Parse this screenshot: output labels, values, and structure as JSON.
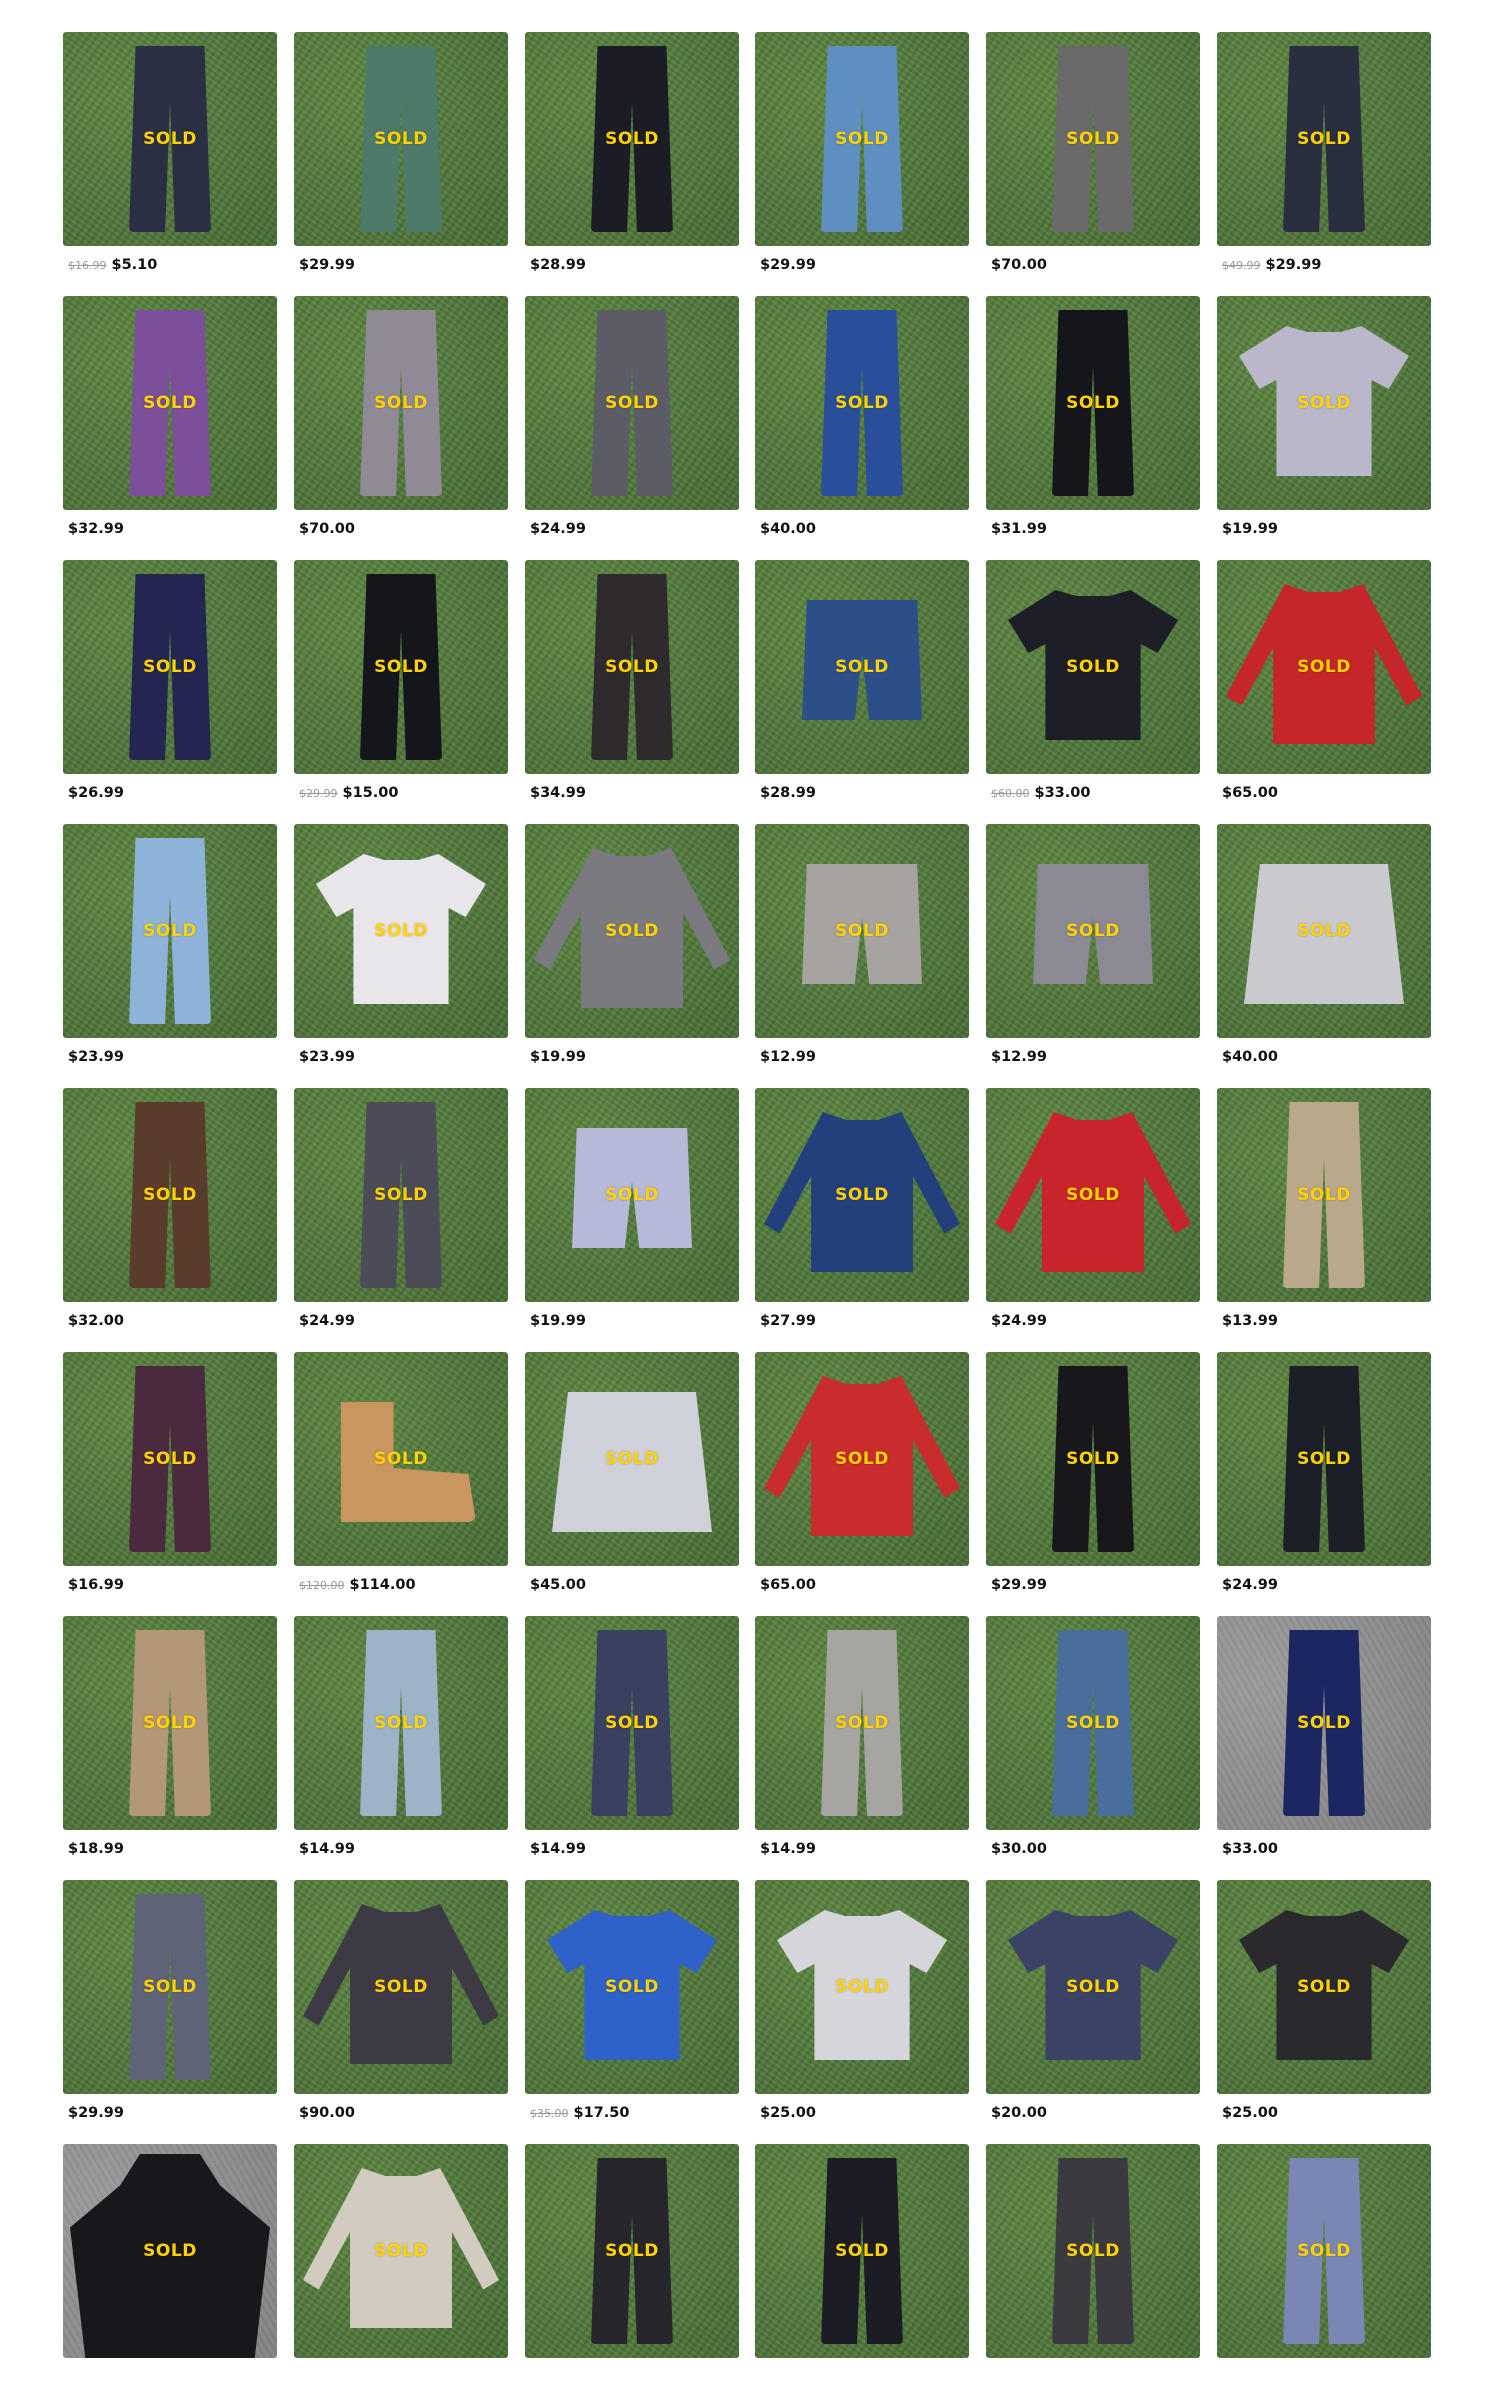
{
  "sold_label": "SOLD",
  "colors": {
    "sold_text": "#ffd200",
    "price_text": "#111111",
    "old_price_text": "#9a9a9a"
  },
  "products": [
    {
      "old_price": "$16.99",
      "price": "$5.10",
      "sold": true,
      "kind": "pants",
      "color": "#2b2f44",
      "bg": "grass"
    },
    {
      "old_price": "",
      "price": "$29.99",
      "sold": true,
      "kind": "pants",
      "color": "#4e7a6a",
      "bg": "grass"
    },
    {
      "old_price": "",
      "price": "$28.99",
      "sold": true,
      "kind": "pants",
      "color": "#1c1d24",
      "bg": "grass"
    },
    {
      "old_price": "",
      "price": "$29.99",
      "sold": true,
      "kind": "pants",
      "color": "#5f8ec0",
      "bg": "grass"
    },
    {
      "old_price": "",
      "price": "$70.00",
      "sold": true,
      "kind": "pants",
      "color": "#6a6a6a",
      "bg": "grass"
    },
    {
      "old_price": "$49.99",
      "price": "$29.99",
      "sold": true,
      "kind": "pants",
      "color": "#2a2f40",
      "bg": "grass"
    },
    {
      "old_price": "",
      "price": "$32.99",
      "sold": true,
      "kind": "pants",
      "color": "#7b4f9a",
      "bg": "grass"
    },
    {
      "old_price": "",
      "price": "$70.00",
      "sold": true,
      "kind": "pants",
      "color": "#8f8a96",
      "bg": "grass"
    },
    {
      "old_price": "",
      "price": "$24.99",
      "sold": true,
      "kind": "pants",
      "color": "#5c5c66",
      "bg": "grass"
    },
    {
      "old_price": "",
      "price": "$40.00",
      "sold": true,
      "kind": "pants",
      "color": "#2a4f9a",
      "bg": "grass"
    },
    {
      "old_price": "",
      "price": "$31.99",
      "sold": true,
      "kind": "pants",
      "color": "#15151c",
      "bg": "grass"
    },
    {
      "old_price": "",
      "price": "$19.99",
      "sold": true,
      "kind": "shirt",
      "color": "#b9b7c9",
      "bg": "grass"
    },
    {
      "old_price": "",
      "price": "$26.99",
      "sold": true,
      "kind": "pants",
      "color": "#232650",
      "bg": "grass"
    },
    {
      "old_price": "$29.99",
      "price": "$15.00",
      "sold": true,
      "kind": "pants",
      "color": "#14161c",
      "bg": "grass"
    },
    {
      "old_price": "",
      "price": "$34.99",
      "sold": true,
      "kind": "pants",
      "color": "#2e2a2e",
      "bg": "grass"
    },
    {
      "old_price": "",
      "price": "$28.99",
      "sold": true,
      "kind": "shorts",
      "color": "#2c4f8a",
      "bg": "grass"
    },
    {
      "old_price": "$60.00",
      "price": "$33.00",
      "sold": true,
      "kind": "shirt",
      "color": "#1e1e26",
      "bg": "grass"
    },
    {
      "old_price": "",
      "price": "$65.00",
      "sold": true,
      "kind": "longsleeve",
      "color": "#c4262a",
      "bg": "grass"
    },
    {
      "old_price": "",
      "price": "$23.99",
      "sold": true,
      "kind": "pants",
      "color": "#8db4d8",
      "bg": "grass"
    },
    {
      "old_price": "",
      "price": "$23.99",
      "sold": true,
      "kind": "shirt",
      "color": "#e8e6ea",
      "bg": "grass"
    },
    {
      "old_price": "",
      "price": "$19.99",
      "sold": true,
      "kind": "longsleeve",
      "color": "#7a7a80",
      "bg": "grass"
    },
    {
      "old_price": "",
      "price": "$12.99",
      "sold": true,
      "kind": "shorts",
      "color": "#a7a3a0",
      "bg": "grass"
    },
    {
      "old_price": "",
      "price": "$12.99",
      "sold": true,
      "kind": "shorts",
      "color": "#8a8994",
      "bg": "grass"
    },
    {
      "old_price": "",
      "price": "$40.00",
      "sold": true,
      "kind": "box",
      "color": "#c9c9cf",
      "bg": "grass"
    },
    {
      "old_price": "",
      "price": "$32.00",
      "sold": true,
      "kind": "pants",
      "color": "#5a3c2c",
      "bg": "grass"
    },
    {
      "old_price": "",
      "price": "$24.99",
      "sold": true,
      "kind": "pants",
      "color": "#4c4c58",
      "bg": "grass"
    },
    {
      "old_price": "",
      "price": "$19.99",
      "sold": true,
      "kind": "shorts",
      "color": "#b7b9d8",
      "bg": "grass"
    },
    {
      "old_price": "",
      "price": "$27.99",
      "sold": true,
      "kind": "longsleeve",
      "color": "#24407c",
      "bg": "grass"
    },
    {
      "old_price": "",
      "price": "$24.99",
      "sold": true,
      "kind": "longsleeve",
      "color": "#c8242b",
      "bg": "grass"
    },
    {
      "old_price": "",
      "price": "$13.99",
      "sold": true,
      "kind": "pants",
      "color": "#b9a98a",
      "bg": "grass"
    },
    {
      "old_price": "",
      "price": "$16.99",
      "sold": true,
      "kind": "pants",
      "color": "#4a2a3c",
      "bg": "grass"
    },
    {
      "old_price": "$120.00",
      "price": "$114.00",
      "sold": true,
      "kind": "boots",
      "color": "#c8965e",
      "bg": "grass"
    },
    {
      "old_price": "",
      "price": "$45.00",
      "sold": true,
      "kind": "box",
      "color": "#cfd1d8",
      "bg": "grass"
    },
    {
      "old_price": "",
      "price": "$65.00",
      "sold": true,
      "kind": "longsleeve",
      "color": "#c82c2c",
      "bg": "grass"
    },
    {
      "old_price": "",
      "price": "$29.99",
      "sold": true,
      "kind": "pants",
      "color": "#18181c",
      "bg": "grass"
    },
    {
      "old_price": "",
      "price": "$24.99",
      "sold": true,
      "kind": "pants",
      "color": "#1c1f26",
      "bg": "grass"
    },
    {
      "old_price": "",
      "price": "$18.99",
      "sold": true,
      "kind": "pants",
      "color": "#b29877",
      "bg": "grass"
    },
    {
      "old_price": "",
      "price": "$14.99",
      "sold": true,
      "kind": "pants",
      "color": "#9cb4c8",
      "bg": "grass"
    },
    {
      "old_price": "",
      "price": "$14.99",
      "sold": true,
      "kind": "pants",
      "color": "#394060",
      "bg": "grass"
    },
    {
      "old_price": "",
      "price": "$14.99",
      "sold": true,
      "kind": "pants",
      "color": "#a7a5a2",
      "bg": "grass"
    },
    {
      "old_price": "",
      "price": "$30.00",
      "sold": true,
      "kind": "pants",
      "color": "#4a6e9c",
      "bg": "grass"
    },
    {
      "old_price": "",
      "price": "$33.00",
      "sold": true,
      "kind": "pants",
      "color": "#1c2660",
      "bg": "concrete"
    },
    {
      "old_price": "",
      "price": "$29.99",
      "sold": true,
      "kind": "pants",
      "color": "#5e6478",
      "bg": "grass"
    },
    {
      "old_price": "",
      "price": "$90.00",
      "sold": true,
      "kind": "longsleeve",
      "color": "#3d3a44",
      "bg": "grass"
    },
    {
      "old_price": "$35.00",
      "price": "$17.50",
      "sold": true,
      "kind": "shirt",
      "color": "#2e62c8",
      "bg": "grass"
    },
    {
      "old_price": "",
      "price": "$25.00",
      "sold": true,
      "kind": "shirt",
      "color": "#d7d5dc",
      "bg": "grass"
    },
    {
      "old_price": "",
      "price": "$20.00",
      "sold": true,
      "kind": "shirt",
      "color": "#3c4266",
      "bg": "grass"
    },
    {
      "old_price": "",
      "price": "$25.00",
      "sold": true,
      "kind": "shirt",
      "color": "#2a2a2e",
      "bg": "grass"
    },
    {
      "old_price": "",
      "price": "",
      "sold": true,
      "kind": "hoodie",
      "color": "#18181c",
      "bg": "concrete"
    },
    {
      "old_price": "",
      "price": "",
      "sold": true,
      "kind": "longsleeve",
      "color": "#d2cbbf",
      "bg": "grass"
    },
    {
      "old_price": "",
      "price": "",
      "sold": true,
      "kind": "pants",
      "color": "#26262c",
      "bg": "grass"
    },
    {
      "old_price": "",
      "price": "",
      "sold": true,
      "kind": "pants",
      "color": "#1c1d24",
      "bg": "grass"
    },
    {
      "old_price": "",
      "price": "",
      "sold": true,
      "kind": "pants",
      "color": "#3a3a40",
      "bg": "grass"
    },
    {
      "old_price": "",
      "price": "",
      "sold": true,
      "kind": "pants",
      "color": "#7a86b4",
      "bg": "grass"
    }
  ]
}
